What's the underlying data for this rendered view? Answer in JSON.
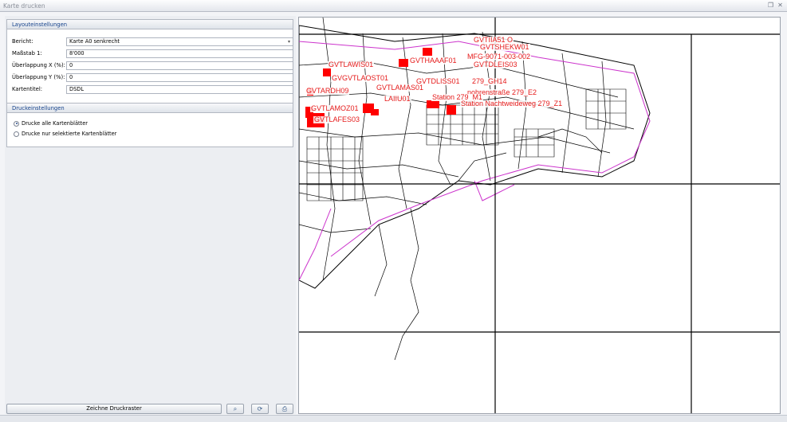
{
  "window": {
    "title": "Karte drucken"
  },
  "layout_group": {
    "header": "Layouteinstellungen",
    "fields": {
      "bericht": {
        "label": "Bericht:",
        "value": "Karte A0 senkrecht"
      },
      "massstab": {
        "label": "Maßstab 1:",
        "value": "8'000"
      },
      "ueberlappung_x": {
        "label": "Überlappung X (%):",
        "value": "0"
      },
      "ueberlappung_y": {
        "label": "Überlappung Y (%):",
        "value": "0"
      },
      "kartentitel": {
        "label": "Kartentitel:",
        "value": "DSDL"
      }
    }
  },
  "print_group": {
    "header": "Druckeinstellungen",
    "options": [
      {
        "label": "Drucke alle Kartenblätter",
        "selected": true
      },
      {
        "label": "Drucke nur selektierte Kartenblätter",
        "selected": false
      }
    ]
  },
  "toolbar": {
    "draw_label": "Zeichne Druckraster",
    "zoom_icon": "magnifier-icon",
    "refresh_icon": "globe-refresh-icon",
    "print_icon": "printer-icon"
  },
  "map": {
    "label_color": "#e51a1a",
    "boundary_color": "#cc33cc",
    "labels": [
      "GVTIIA51 O",
      "GVTSHEKW01",
      "MFG-9071-003-002",
      "GVTHAAAF01",
      "GVTDLEIS03",
      "GVTLAWIS01",
      "GVGVTLAOST01",
      "GVTDLISS01",
      "279_GH14",
      "GVTARDH09",
      "GVTLAMAS01",
      "nohrenstraße 279_E2",
      "Station 279_M1",
      "LAIIU01",
      "Station Nachtweideweg 279_Z1",
      "GVTLAMOZ01",
      "GVTLAFES03"
    ]
  }
}
